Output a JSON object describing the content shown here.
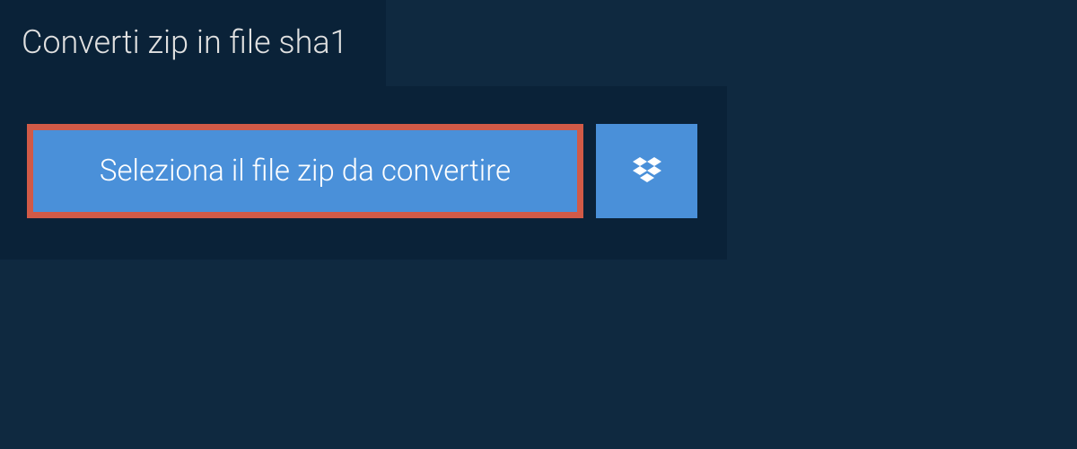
{
  "tab": {
    "title": "Converti zip in file sha1"
  },
  "panel": {
    "select_button_label": "Seleziona il file zip da convertire"
  },
  "colors": {
    "background": "#0f2940",
    "panel_background": "#0a2238",
    "button_background": "#4a90d9",
    "highlight_border": "#d15a47",
    "text_light": "#e0e0e0",
    "text_white": "#ffffff"
  },
  "icons": {
    "dropbox": "dropbox-icon"
  }
}
